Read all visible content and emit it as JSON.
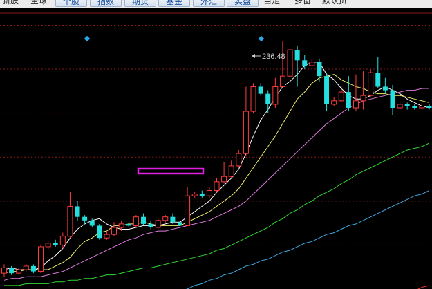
{
  "toolbar": {
    "tabs": [
      {
        "label": "新股"
      },
      {
        "label": "全球"
      },
      {
        "label": "个股"
      },
      {
        "label": "指数"
      },
      {
        "label": "期货"
      },
      {
        "label": "基金"
      },
      {
        "label": "外汇"
      },
      {
        "label": "实盘"
      },
      {
        "label": "自定"
      },
      {
        "label": "多窗"
      },
      {
        "label": "默认页"
      }
    ]
  },
  "colors": {
    "background": "#000000",
    "grid": "#8a1a1a",
    "candle_up": "#ff3c3c",
    "candle_down": "#25dede",
    "marker": "#2aa7e8",
    "highlight_box": "#e020e0",
    "ma5": "#ffffff",
    "ma10": "#f2ee6b",
    "ma20": "#e07be0",
    "ma60": "#33d933",
    "ma120": "#3fa9e0",
    "ma250": "#ff3030"
  },
  "annotations": {
    "high_price": "236.48"
  },
  "chart_data": {
    "type": "candlestick",
    "y_scale": "price",
    "y_range": [
      95,
      255
    ],
    "grid_levels": [
      245,
      220,
      195,
      170,
      145,
      120
    ],
    "high_label_value": 236.48,
    "candles": [
      [
        104,
        107,
        102,
        109
      ],
      [
        107,
        104,
        103,
        108
      ],
      [
        104,
        106,
        103,
        107
      ],
      [
        106,
        108,
        105,
        109
      ],
      [
        108,
        105,
        104,
        109
      ],
      [
        105,
        119,
        104,
        120
      ],
      [
        119,
        121,
        117,
        122
      ],
      [
        121,
        120,
        119,
        123
      ],
      [
        120,
        125,
        118,
        127
      ],
      [
        125,
        142,
        124,
        150
      ],
      [
        142,
        136,
        134,
        145
      ],
      [
        136,
        134,
        132,
        137
      ],
      [
        134,
        131,
        130,
        135
      ],
      [
        131,
        124,
        123,
        132
      ],
      [
        124,
        126,
        123,
        128
      ],
      [
        126,
        130,
        125,
        133
      ],
      [
        130,
        132,
        128,
        134
      ],
      [
        132,
        131,
        130,
        133
      ],
      [
        131,
        136,
        130,
        137
      ],
      [
        136,
        132,
        131,
        138
      ],
      [
        132,
        130,
        129,
        134
      ],
      [
        130,
        134,
        129,
        135
      ],
      [
        134,
        136,
        133,
        137
      ],
      [
        136,
        133,
        132,
        138
      ],
      [
        133,
        131,
        126,
        134
      ],
      [
        131,
        148,
        131,
        153
      ],
      [
        148,
        149,
        147,
        150
      ],
      [
        149,
        148,
        147,
        151
      ],
      [
        148,
        151,
        147,
        153
      ],
      [
        151,
        156,
        150,
        158
      ],
      [
        156,
        159,
        155,
        167
      ],
      [
        159,
        165,
        158,
        168
      ],
      [
        165,
        172,
        164,
        174
      ],
      [
        172,
        196,
        171,
        210
      ],
      [
        196,
        210,
        195,
        212
      ],
      [
        210,
        206,
        205,
        212
      ],
      [
        206,
        200,
        195,
        208
      ],
      [
        200,
        210,
        198,
        215
      ],
      [
        210,
        216,
        209,
        236
      ],
      [
        216,
        231,
        215,
        233
      ],
      [
        231,
        225,
        210,
        233
      ],
      [
        225,
        222,
        220,
        228
      ],
      [
        222,
        224,
        222,
        226
      ],
      [
        224,
        216,
        213,
        226
      ],
      [
        216,
        200,
        196,
        218
      ],
      [
        200,
        202,
        199,
        204
      ],
      [
        202,
        207,
        201,
        210
      ],
      [
        207,
        198,
        196,
        216
      ],
      [
        198,
        202,
        196,
        217
      ],
      [
        202,
        205,
        197,
        219
      ],
      [
        205,
        218,
        204,
        220
      ],
      [
        218,
        210,
        209,
        227
      ],
      [
        210,
        208,
        206,
        215
      ],
      [
        208,
        198,
        194,
        211
      ],
      [
        198,
        200,
        196,
        202
      ],
      [
        200,
        199,
        197,
        201
      ],
      [
        199,
        198,
        197,
        200
      ],
      [
        198,
        199,
        197,
        201
      ],
      [
        199,
        198,
        197,
        200
      ]
    ],
    "series": [
      {
        "key": "ma5",
        "values": [
          106,
          107,
          106,
          106,
          106,
          107,
          111,
          114,
          118,
          124,
          129,
          132,
          134,
          135,
          132,
          130,
          129,
          129,
          130,
          131,
          131,
          131,
          132,
          133,
          133,
          136,
          139,
          142,
          145,
          150,
          154,
          158,
          163,
          172,
          182,
          191,
          197,
          204,
          210,
          213,
          217,
          222,
          224,
          224,
          217,
          214,
          209,
          205,
          203,
          203,
          205,
          208,
          210,
          208,
          206,
          203,
          201,
          199,
          198
        ]
      },
      {
        "key": "ma10",
        "values": [
          104,
          105,
          105,
          106,
          106,
          106,
          106,
          108,
          110,
          113,
          118,
          122,
          124,
          127,
          128,
          131,
          131,
          132,
          132,
          133,
          132,
          131,
          131,
          131,
          131,
          133,
          135,
          137,
          139,
          142,
          145,
          148,
          152,
          158,
          164,
          170,
          176,
          182,
          189,
          196,
          203,
          207,
          212,
          215,
          216,
          217,
          214,
          212,
          210,
          209,
          207,
          206,
          206,
          205,
          205,
          204,
          203,
          202,
          201
        ]
      },
      {
        "key": "ma20",
        "values": [
          100,
          101,
          101,
          102,
          102,
          102,
          103,
          104,
          105,
          107,
          109,
          111,
          113,
          115,
          117,
          119,
          121,
          123,
          124,
          126,
          127,
          128,
          128,
          129,
          130,
          131,
          132,
          133,
          134,
          136,
          138,
          140,
          142,
          145,
          149,
          153,
          157,
          161,
          165,
          169,
          173,
          177,
          181,
          185,
          189,
          192,
          195,
          198,
          200,
          202,
          203,
          204,
          205,
          206,
          207,
          208,
          208,
          209,
          209
        ]
      },
      {
        "key": "ma60",
        "values": [
          97,
          97,
          97,
          98,
          98,
          98,
          98,
          99,
          99,
          100,
          100,
          101,
          101,
          102,
          103,
          103,
          104,
          105,
          106,
          107,
          107,
          108,
          109,
          110,
          111,
          112,
          113,
          114,
          115,
          117,
          118,
          120,
          122,
          124,
          126,
          128,
          130,
          133,
          135,
          138,
          140,
          143,
          145,
          148,
          150,
          152,
          155,
          157,
          160,
          162,
          164,
          166,
          168,
          170,
          172,
          174,
          175,
          176,
          178
        ]
      },
      {
        "key": "ma120",
        "values": [
          null,
          null,
          null,
          null,
          null,
          null,
          null,
          null,
          null,
          null,
          null,
          null,
          null,
          null,
          null,
          null,
          null,
          null,
          null,
          null,
          null,
          null,
          null,
          null,
          94,
          95,
          97,
          98,
          100,
          101,
          103,
          104,
          106,
          108,
          109,
          111,
          112,
          114,
          116,
          117,
          119,
          121,
          122,
          124,
          126,
          127,
          129,
          131,
          132,
          134,
          136,
          138,
          140,
          142,
          144,
          146,
          148,
          149,
          151
        ]
      },
      {
        "key": "ma250",
        "values": [
          null,
          null,
          null,
          null,
          null,
          null,
          null,
          null,
          null,
          null,
          null,
          null,
          null,
          null,
          null,
          null,
          null,
          null,
          null,
          null,
          null,
          null,
          null,
          null,
          null,
          null,
          null,
          null,
          null,
          null,
          null,
          null,
          null,
          null,
          null,
          null,
          null,
          null,
          null,
          null,
          null,
          null,
          null,
          null,
          null,
          null,
          null,
          null,
          null,
          null,
          null,
          null,
          null,
          null,
          null,
          93,
          94,
          96,
          97
        ]
      }
    ]
  }
}
